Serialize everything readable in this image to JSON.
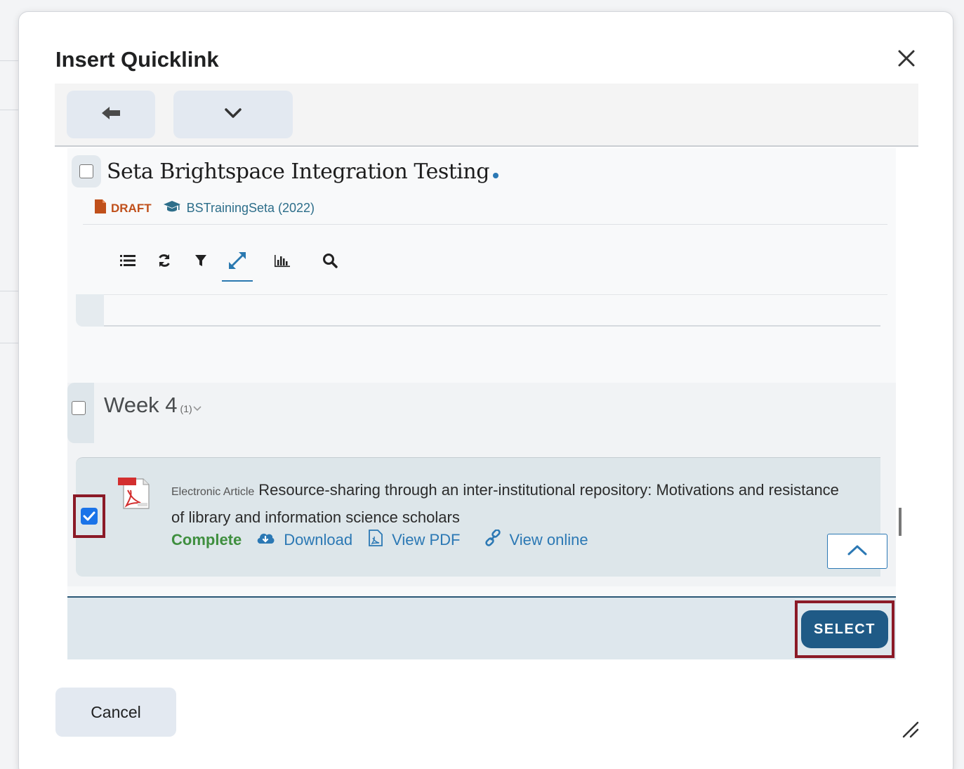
{
  "dialog": {
    "title": "Insert Quicklink",
    "cancel_label": "Cancel"
  },
  "reading_list": {
    "title": "Seta Brightspace Integration Testing",
    "status": "DRAFT",
    "course": "BSTrainingSeta (2022)"
  },
  "section": {
    "title": "Week 4",
    "count": "(1)"
  },
  "citation": {
    "type": "Electronic Article",
    "title": "Resource-sharing through an inter-institutional repository: Motivations and resistance of library and information science scholars",
    "status": "Complete",
    "download_label": "Download",
    "view_pdf_label": "View PDF",
    "view_online_label": "View online"
  },
  "footer": {
    "select_label": "SELECT"
  },
  "icons": {
    "back": "arrow-left-icon",
    "menu": "chevron-down-icon",
    "close": "close-icon",
    "list": "list-icon",
    "refresh": "refresh-icon",
    "filter": "filter-icon",
    "expand": "expand-icon",
    "stats": "bar-chart-icon",
    "search": "search-icon"
  },
  "colors": {
    "accent": "#2b78b4",
    "highlight": "#8b1a27",
    "select_button": "#1f5a86",
    "draft": "#c0501b",
    "complete": "#3f8f3f"
  }
}
